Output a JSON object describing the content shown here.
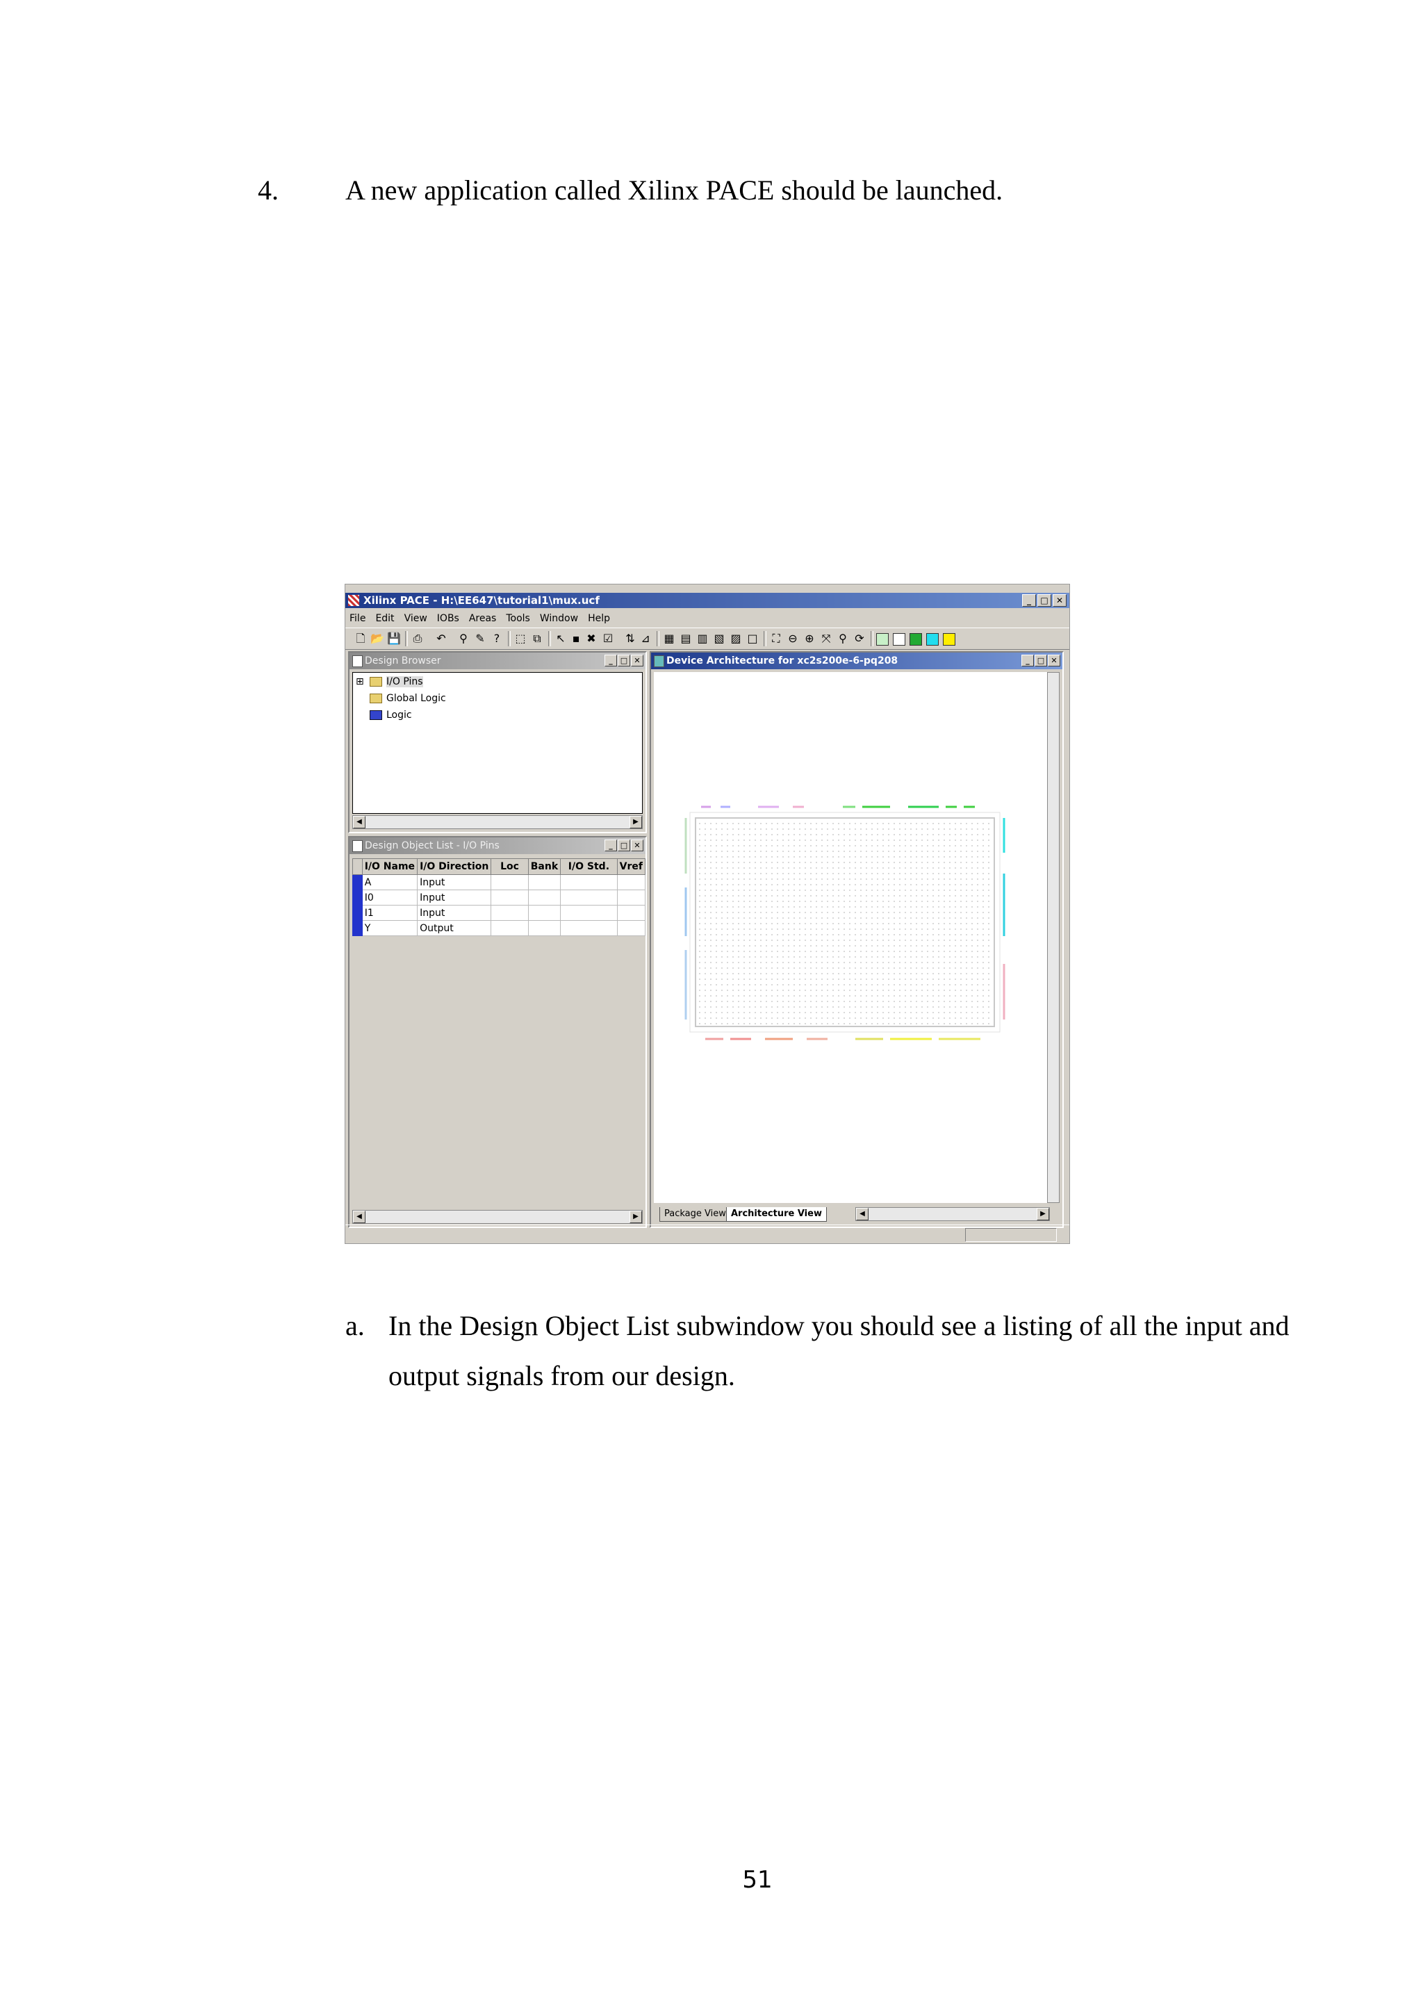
{
  "step": {
    "number": "4.",
    "text": "A new application called Xilinx PACE should be launched."
  },
  "substep": {
    "letter": "a.",
    "text": "In the Design Object List subwindow you should see a listing of all the input and output signals from our design."
  },
  "page_number": "51",
  "app": {
    "title": "Xilinx PACE - H:\\EE647\\tutorial1\\mux.ucf",
    "menu": [
      "File",
      "Edit",
      "View",
      "IOBs",
      "Areas",
      "Tools",
      "Window",
      "Help"
    ],
    "toolbar_colors": [
      "#c8f0c8",
      "#ffffff",
      "#22aa33",
      "#22ddee",
      "#ffee00"
    ]
  },
  "design_browser": {
    "title": "Design Browser",
    "items": [
      "I/O Pins",
      "Global Logic",
      "Logic"
    ]
  },
  "object_list": {
    "title": "Design Object List - I/O Pins",
    "columns": [
      "I/O Name",
      "I/O Direction",
      "Loc",
      "Bank",
      "I/O Std.",
      "Vref"
    ],
    "rows": [
      {
        "name": "A",
        "direction": "Input"
      },
      {
        "name": "I0",
        "direction": "Input"
      },
      {
        "name": "I1",
        "direction": "Input"
      },
      {
        "name": "Y",
        "direction": "Output"
      }
    ]
  },
  "device_arch": {
    "title": "Device Architecture for xc2s200e-6-pq208",
    "tabs": [
      "Package View",
      "Architecture View"
    ]
  }
}
